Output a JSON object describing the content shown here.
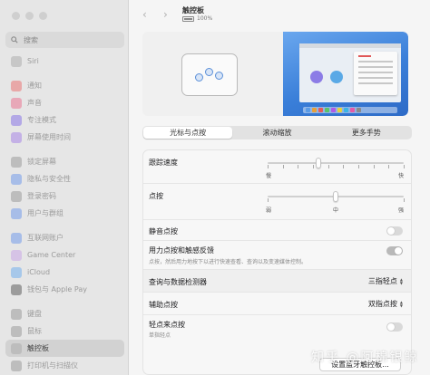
{
  "sidebar": {
    "search_placeholder": "搜索",
    "items": [
      {
        "label": "Siri",
        "icon": "siri-icon",
        "color": "#c7c7c7"
      },
      {
        "label": "通知",
        "icon": "bell-icon",
        "color": "#e8a8a8"
      },
      {
        "label": "声音",
        "icon": "speaker-icon",
        "color": "#e8a8b8"
      },
      {
        "label": "专注模式",
        "icon": "moon-icon",
        "color": "#b3a8e6"
      },
      {
        "label": "屏幕使用时间",
        "icon": "hourglass-icon",
        "color": "#c4b1e6"
      },
      {
        "label": "锁定屏幕",
        "icon": "lock-screen-icon",
        "color": "#bdbdbd"
      },
      {
        "label": "隐私与安全性",
        "icon": "hand-icon",
        "color": "#a7bde8"
      },
      {
        "label": "登录密码",
        "icon": "key-icon",
        "color": "#bdbdbd"
      },
      {
        "label": "用户与群组",
        "icon": "users-icon",
        "color": "#a7bde8"
      },
      {
        "label": "互联网账户",
        "icon": "at-icon",
        "color": "#a7bde8"
      },
      {
        "label": "Game Center",
        "icon": "game-center-icon",
        "color": "#d6c3e6"
      },
      {
        "label": "iCloud",
        "icon": "cloud-icon",
        "color": "#a7c8ea"
      },
      {
        "label": "钱包与 Apple Pay",
        "icon": "wallet-icon",
        "color": "#9c9c9c"
      },
      {
        "label": "键盘",
        "icon": "keyboard-icon",
        "color": "#bdbdbd"
      },
      {
        "label": "鼠标",
        "icon": "mouse-icon",
        "color": "#bdbdbd"
      },
      {
        "label": "触控板",
        "icon": "trackpad-icon",
        "color": "#bdbdbd",
        "selected": true
      },
      {
        "label": "打印机与扫描仪",
        "icon": "printer-icon",
        "color": "#bdbdbd"
      }
    ]
  },
  "header": {
    "title": "触控板",
    "battery_percent": "100%"
  },
  "tabs": [
    {
      "label": "光标与点按",
      "selected": true
    },
    {
      "label": "滚动缩放",
      "selected": false
    },
    {
      "label": "更多手势",
      "selected": false
    }
  ],
  "settings": {
    "tracking": {
      "label": "跟踪速度",
      "min_label": "慢",
      "max_label": "快",
      "value": 0.37
    },
    "click": {
      "label": "点按",
      "left_label": "弱",
      "mid_label": "中",
      "right_label": "强",
      "value": 0.5
    },
    "silent_click": {
      "label": "静音点按",
      "on": false
    },
    "force_click": {
      "label": "用力点按和触感反馈",
      "description": "点按，然后用力地按下以进行快速查看、查询以及变速媒体控制。",
      "on": true
    },
    "lookup": {
      "label": "查询与数据检测器",
      "value": "三指轻点"
    },
    "secondary_click": {
      "label": "辅助点按",
      "value": "双指点按"
    },
    "tap_to_click": {
      "label": "轻点来点按",
      "description": "单指轻点",
      "on": false
    }
  },
  "footer": {
    "bluetooth_button": "设置蓝牙触控板..."
  },
  "watermark": "知乎 @阿棉银鲸",
  "colors": {
    "accent": "#3a7fd9"
  }
}
